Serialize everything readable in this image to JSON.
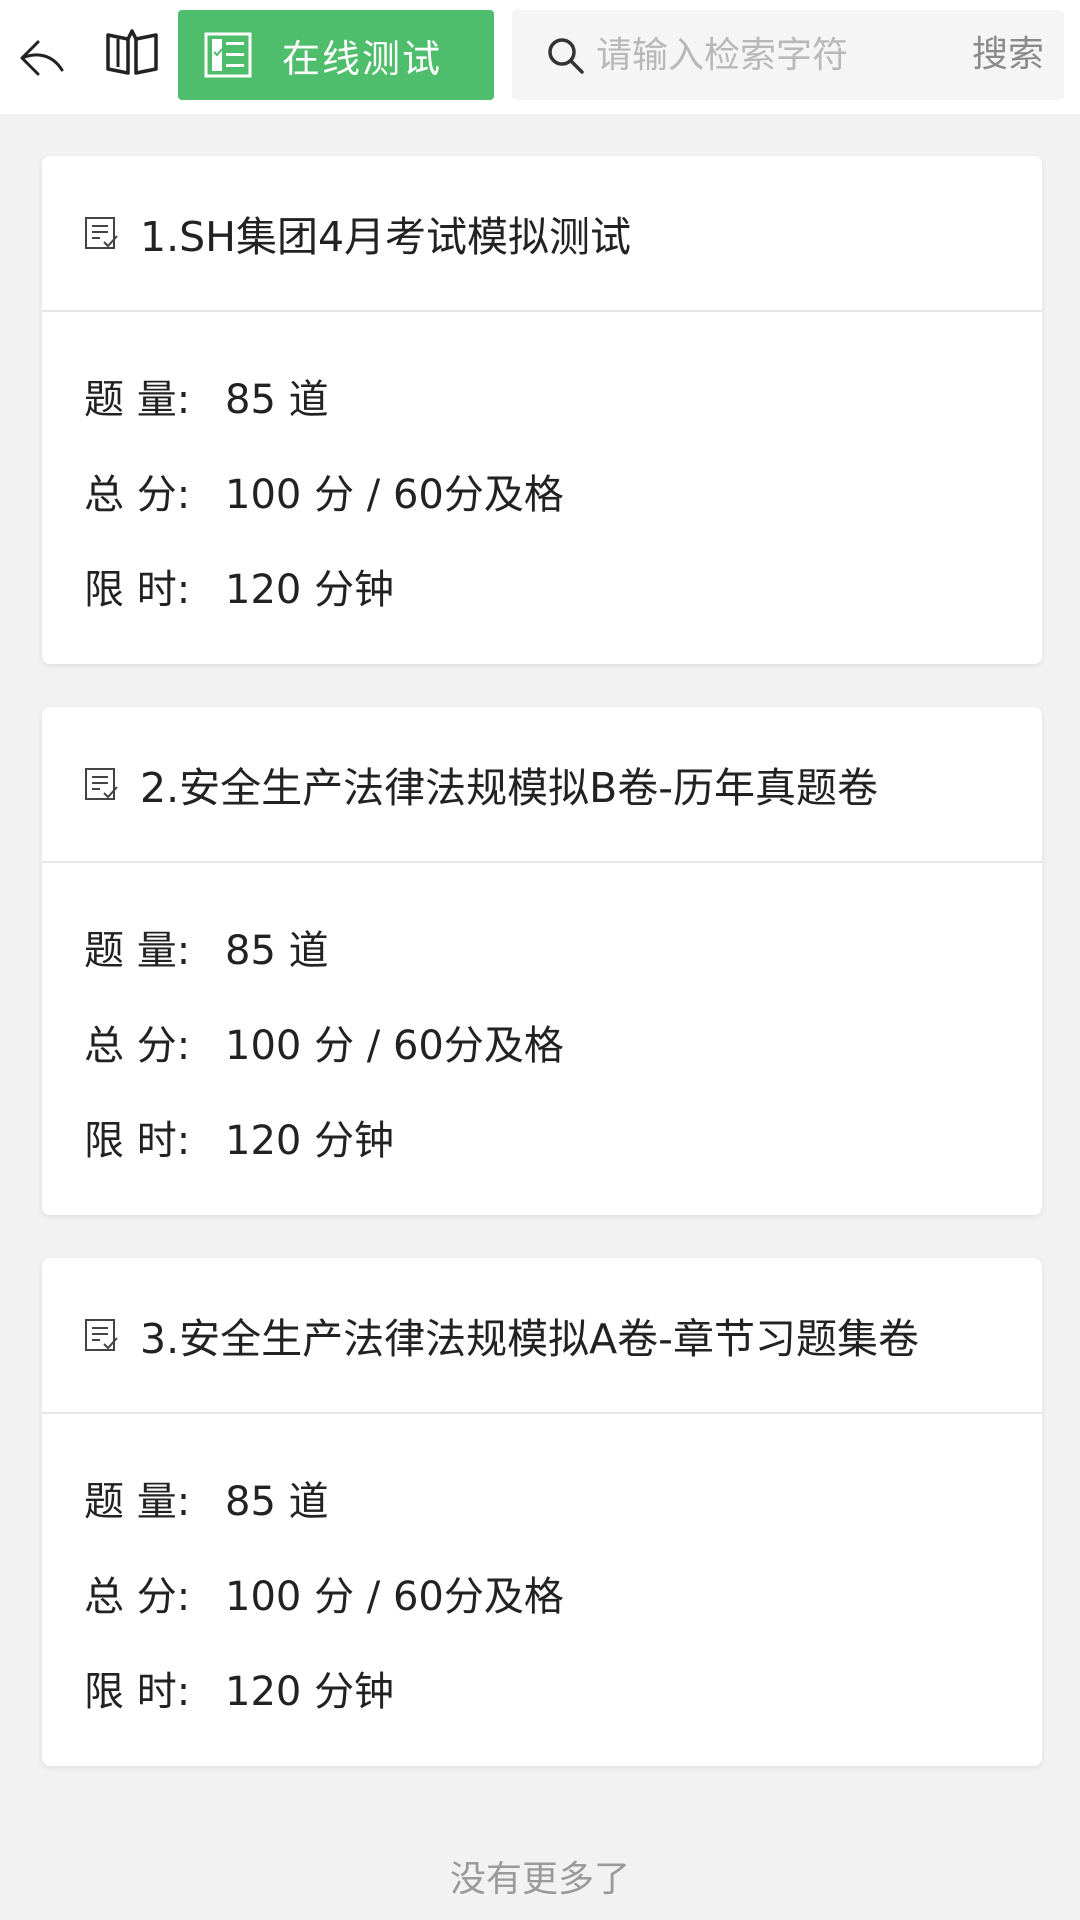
{
  "toolbar": {
    "back_icon": "back-arrow-icon",
    "book_icon": "open-book-icon",
    "tab": {
      "label": "在线测试",
      "icon": "test-list-icon",
      "color": "#4fbe6c"
    },
    "search": {
      "placeholder": "请输入检索字符",
      "value": "",
      "button": "搜索",
      "icon": "search-icon"
    }
  },
  "exams": [
    {
      "title": "1.SH集团4月考试模拟测试",
      "icon": "document-icon",
      "rows": [
        {
          "label": "题 量:",
          "value": "85 道"
        },
        {
          "label": "总 分:",
          "value": "100 分 / 60分及格"
        },
        {
          "label": "限 时:",
          "value": "120 分钟"
        }
      ]
    },
    {
      "title": "2.安全生产法律法规模拟B卷-历年真题卷",
      "icon": "document-icon",
      "rows": [
        {
          "label": "题 量:",
          "value": "85 道"
        },
        {
          "label": "总 分:",
          "value": "100 分 / 60分及格"
        },
        {
          "label": "限 时:",
          "value": "120 分钟"
        }
      ]
    },
    {
      "title": "3.安全生产法律法规模拟A卷-章节习题集卷",
      "icon": "document-icon",
      "rows": [
        {
          "label": "题 量:",
          "value": "85 道"
        },
        {
          "label": "总 分:",
          "value": "100 分 / 60分及格"
        },
        {
          "label": "限 时:",
          "value": "120 分钟"
        }
      ]
    }
  ],
  "footer": {
    "text": "没有更多了"
  }
}
